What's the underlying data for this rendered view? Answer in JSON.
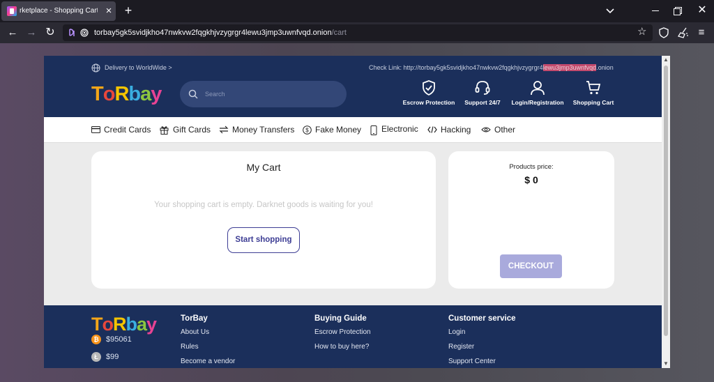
{
  "browser": {
    "tab_title": "rketplace - Shopping Cart - Torb",
    "url_main": "torbay5gk5svidjkho47nwkvw2fqgkhjvzygrgr4lewu3jmp3uwnfvqd.onion",
    "url_path": "/cart"
  },
  "header": {
    "delivery": "Delivery to WorldWide >",
    "check_link_prefix": "Check Link: http://torbay5gk5svidjkho47nwkvw2fqgkhjvzygrgr4",
    "check_link_highlight": "lewu3jmp3uwnfvqd",
    "check_link_suffix": ".onion",
    "search_placeholder": "Search",
    "actions": {
      "escrow": "Escrow Protection",
      "support": "Support 24/7",
      "login": "Login/Registration",
      "cart": "Shopping Cart"
    }
  },
  "logo": {
    "letters": [
      "T",
      "o",
      "R",
      "b",
      "a",
      "y"
    ],
    "colors": [
      "#f4a619",
      "#e8473c",
      "#f4c400",
      "#3aaee0",
      "#8cc63f",
      "#e84393"
    ]
  },
  "categories": {
    "credit_cards": "Credit Cards",
    "gift_cards": "Gift Cards",
    "money_transfers": "Money Transfers",
    "fake_money": "Fake Money",
    "electronic": "Electronic",
    "hacking": "Hacking",
    "other": "Other"
  },
  "cart": {
    "title": "My Cart",
    "empty_message": "Your shopping cart is empty. Darknet goods is waiting for you!",
    "start_button": "Start shopping"
  },
  "price": {
    "label": "Products price:",
    "value": "$ 0",
    "checkout": "CHECKOUT"
  },
  "footer": {
    "btc": "$95061",
    "ltc": "$99",
    "columns": {
      "torbay": {
        "title": "TorBay",
        "links": [
          "About Us",
          "Rules",
          "Become a vendor"
        ]
      },
      "guide": {
        "title": "Buying Guide",
        "links": [
          "Escrow Protection",
          "How to buy here?"
        ]
      },
      "service": {
        "title": "Customer service",
        "links": [
          "Login",
          "Register",
          "Support Center"
        ]
      }
    }
  },
  "colors": {
    "brand_navy": "#1b2f5b",
    "accent_purple": "#3d3d94",
    "checkout_disabled": "#a9aadc",
    "url_highlight": "#c44a6d",
    "btc": "#f7931a",
    "ltc": "#b8b8b8"
  }
}
